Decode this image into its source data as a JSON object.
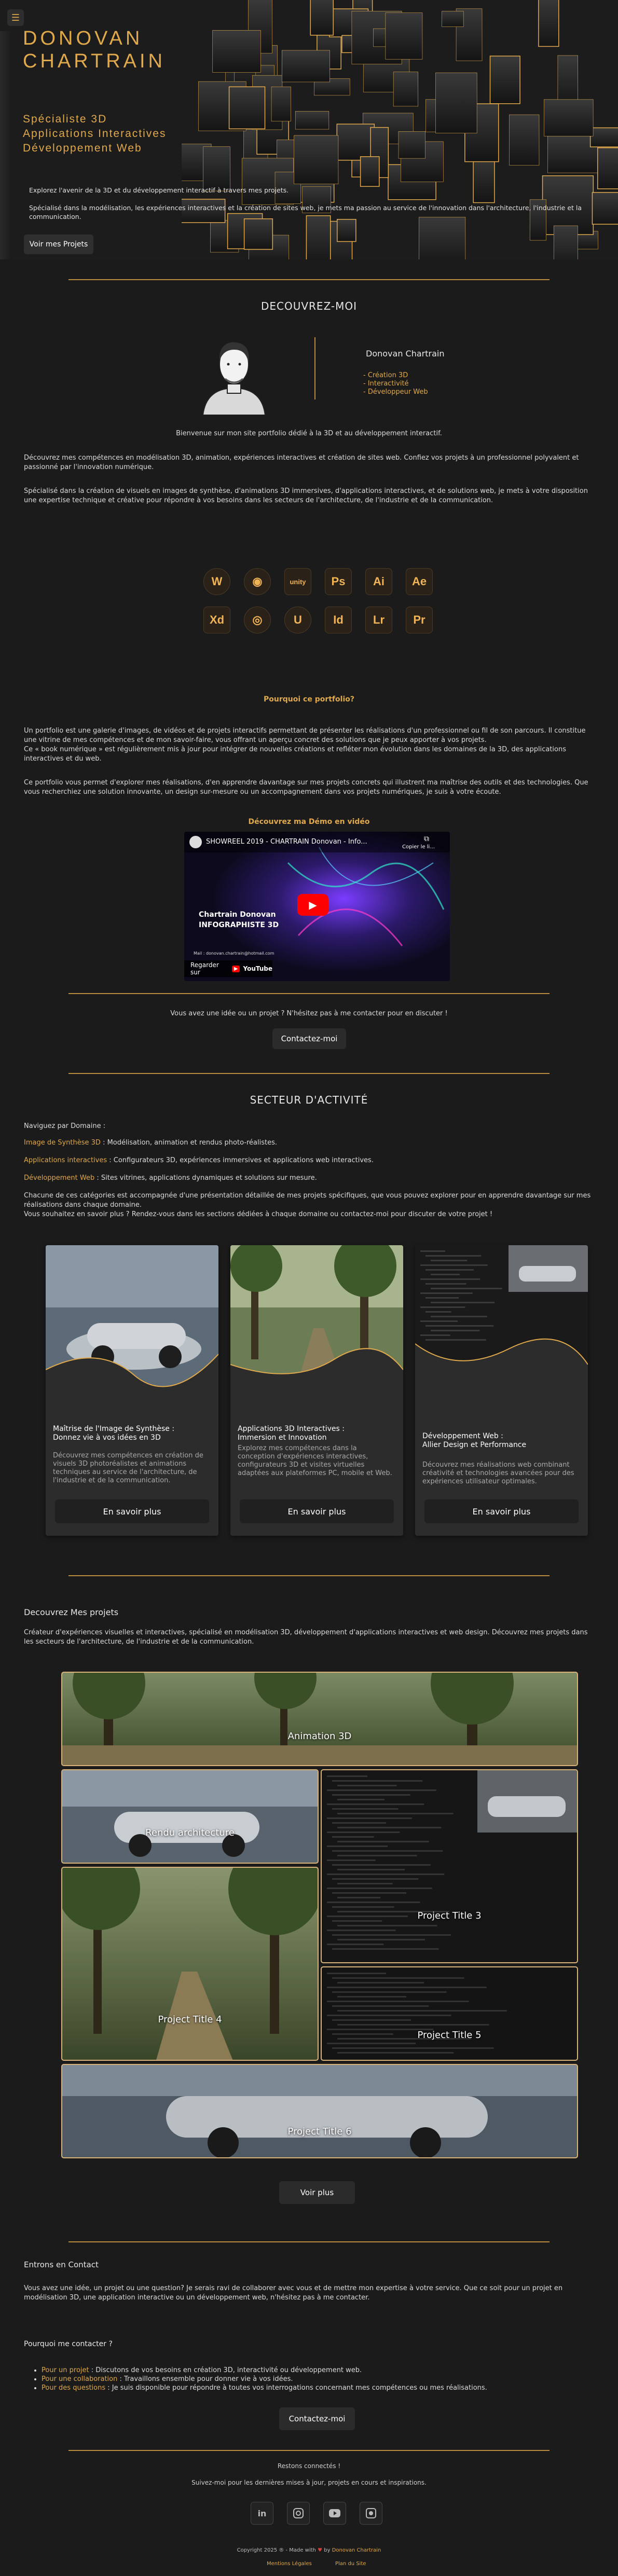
{
  "header": {
    "menu_icon": "hamburger-icon",
    "name_line1": "DONOVAN",
    "name_line2": "CHARTRAIN",
    "sub1": "Spécialiste 3D",
    "sub2": "Applications Interactives",
    "sub3": "Développement Web",
    "intro1": "Explorez l'avenir de la 3D et du développement interactif à travers mes projets.",
    "intro2": "Spécialisé dans la modélisation, les expériences interactives et la création de sites web, je mets ma passion au service de l'innovation dans l'architecture, l'industrie et la communication.",
    "projects_button": "Voir mes Projets"
  },
  "about": {
    "title": "DECOUVREZ-MOI",
    "person": "Donovan Chartrain",
    "skills": [
      "- Création 3D",
      "- Interactivité",
      "- Développeur Web"
    ],
    "welcome": "Bienvenue sur mon site portfolio dédié à la 3D et au développement interactif.",
    "p1": "Découvrez mes compétences en modélisation 3D, animation, expériences interactives et création de sites web. Confiez vos projets à un professionnel polyvalent et passionné par l'innovation numérique.",
    "p2": "Spécialisé dans la création de visuels en images de synthèse, d'animations 3D immersives, d'applications interactives, et de solutions web, je mets à votre disposition une expertise technique et créative pour répondre à vos besoins dans les secteurs de l'architecture, de l'industrie et de la communication."
  },
  "tools": [
    {
      "name": "wordpress-icon",
      "label": "W",
      "round": true
    },
    {
      "name": "blender-icon",
      "label": "◉",
      "round": true
    },
    {
      "name": "unity-icon",
      "label": "unity",
      "round": false
    },
    {
      "name": "photoshop-icon",
      "label": "Ps",
      "round": false
    },
    {
      "name": "illustrator-icon",
      "label": "Ai",
      "round": false
    },
    {
      "name": "after-effects-icon",
      "label": "Ae",
      "round": false
    },
    {
      "name": "xd-icon",
      "label": "Xd",
      "round": false
    },
    {
      "name": "cinema4d-icon",
      "label": "◎",
      "round": true
    },
    {
      "name": "unreal-icon",
      "label": "U",
      "round": true
    },
    {
      "name": "indesign-icon",
      "label": "Id",
      "round": false
    },
    {
      "name": "lightroom-icon",
      "label": "Lr",
      "round": false
    },
    {
      "name": "premiere-icon",
      "label": "Pr",
      "round": false
    }
  ],
  "why": {
    "title": "Pourquoi ce portfolio?",
    "p1": "Un portfolio est une galerie d'images, de vidéos et de projets interactifs permettant de présenter les réalisations d'un professionnel ou fil de son parcours. Il constitue une vitrine de mes compétences et de mon savoir-faire, vous offrant un aperçu concret des solutions que je peux apporter à vos projets.",
    "p2": "Ce « book numérique » est régulièrement mis à jour pour intégrer de nouvelles créations et refléter mon évolution dans les domaines de la 3D, des applications interactives et du web.",
    "p3": "Ce portfolio vous permet d'explorer mes réalisations, d'en apprendre davantage sur mes projets concrets qui illustrent ma maîtrise des outils et des technologies. Que vous recherchiez une solution innovante, un design sur-mesure ou un accompagnement dans vos projets numériques, je suis à votre écoute."
  },
  "demo": {
    "title": "Découvrez ma Démo en vidéo",
    "video_title": "SHOWREEL 2019 - CHARTRAIN Donovan - Info...",
    "copy_link": "Copier le li...",
    "channel_line1": "Chartrain Donovan",
    "channel_line2": "INFOGRAPHISTE 3D",
    "mail": "Mail : donovan.chartrain@hotmail.com",
    "watch_on": "Regarder sur",
    "youtube": "YouTube"
  },
  "cta1": {
    "text": "Vous avez une idée ou un projet ? N'hésitez pas à me contacter pour en discuter !",
    "button": "Contactez-moi"
  },
  "sector": {
    "title": "SECTEUR D'ACTIVITÉ",
    "nav": "Naviguez par Domaine :",
    "items": [
      {
        "label": "Image de Synthèse 3D",
        "desc": " : Modélisation, animation et rendus photo-réalistes."
      },
      {
        "label": "Applications interactives",
        "desc": " : Configurateurs 3D, expériences immersives et applications web interactives."
      },
      {
        "label": "Développement Web",
        "desc": " : Sites vitrines, applications dynamiques et solutions sur mesure."
      }
    ],
    "p1": "Chacune de ces catégories est accompagnée d'une présentation détaillée de mes projets spécifiques, que vous pouvez explorer pour en apprendre davantage sur mes réalisations dans chaque domaine.",
    "p2": "Vous souhaitez en savoir plus ? Rendez-vous dans les sections dédiées à chaque domaine ou contactez-moi pour discuter de votre projet !"
  },
  "cards": [
    {
      "title": "Maîtrise de l'Image de Synthèse :\nDonnez vie à vos idées en 3D",
      "text": "Découvrez mes compétences en création de visuels 3D photoréalistes et animations techniques au service de l'architecture, de l'industrie et de la communication.",
      "button": "En savoir plus"
    },
    {
      "title": "Applications 3D Interactives :\nImmersion et Innovation",
      "text": "Explorez mes compétences dans la conception d'expériences interactives, configurateurs 3D et visites virtuelles adaptées aux plateformes PC, mobile et Web.",
      "button": "En savoir plus"
    },
    {
      "title": "Développement Web :\nAllier Design et Performance",
      "text": "Découvrez mes réalisations web combinant créativité et technologies avancées pour des expériences utilisateur optimales.",
      "button": "En savoir plus"
    }
  ],
  "projects": {
    "title": "Decouvrez Mes projets",
    "p": "Créateur d'expériences visuelles et interactives, spécialisé en modélisation 3D, développement d'applications interactives et web design. Découvrez mes projets dans les secteurs de l'architecture, de l'industrie et de la communication.",
    "items": [
      "Animation 3D",
      "Rendu architecture",
      "Project Title 3",
      "Project Title 4",
      "Project Title 5",
      "Project Title 6"
    ],
    "more_button": "Voir plus"
  },
  "contact": {
    "title": "Entrons en Contact",
    "p": "Vous avez une idée, un projet ou une question? Je serais ravi de collaborer avec vous et de mettre mon expertise à votre service. Que ce soit pour un projet en modélisation 3D, une application interactive ou un développement web, n'hésitez pas à me contacter.",
    "why": "Pourquoi me contacter ?",
    "reasons": [
      {
        "label": "Pour un projet",
        "text": " : Discutons de vos besoins en création 3D, interactivité ou développement web."
      },
      {
        "label": "Pour une collaboration",
        "text": " : Travaillons ensemble pour donner vie à vos idées."
      },
      {
        "label": "Pour des questions",
        "text": " : Je suis disponible pour répondre à toutes vos interrogations concernant mes compétences ou mes réalisations."
      }
    ],
    "button": "Contactez-moi"
  },
  "footer": {
    "connected": "Restons connectés !",
    "follow": "Suivez-moi pour les dernières mises à jour, projets en cours et inspirations.",
    "socials": [
      "linkedin-icon",
      "instagram-icon",
      "youtube-icon",
      "github-icon"
    ],
    "copyright_pre": "Copyright 2025 ® - Made with",
    "copyright_by": "by",
    "copyright_name": "Donovan Chartrain",
    "legal": "Mentions Légales",
    "plan": "Plan du Site"
  },
  "colors": {
    "accent": "#e0a94c",
    "background": "#1b1b1b",
    "card": "#2c2c2c"
  }
}
